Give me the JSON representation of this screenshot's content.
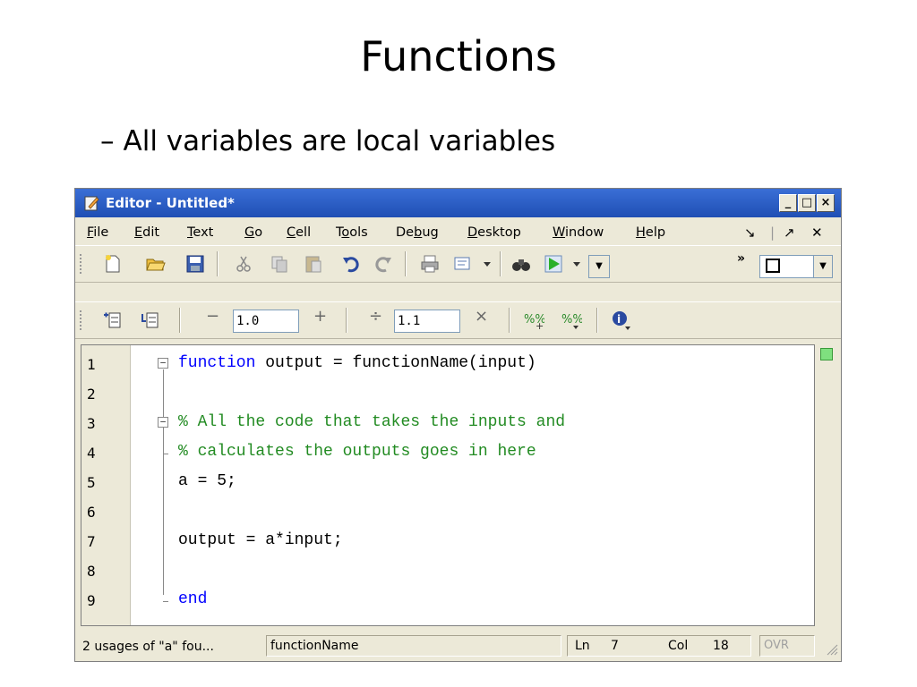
{
  "slide": {
    "title": "Functions",
    "bullet_dash": "–",
    "bullet": "All variables are local variables"
  },
  "window": {
    "title": "Editor - Untitled*",
    "minimize": "_",
    "maximize": "□",
    "close": "×"
  },
  "menu": {
    "file": {
      "u": "F",
      "rest": "ile"
    },
    "edit": {
      "pre": "",
      "u": "E",
      "rest": "dit"
    },
    "text": {
      "u": "T",
      "rest": "ext"
    },
    "go": {
      "u": "G",
      "rest": "o"
    },
    "cell": {
      "u": "C",
      "rest": "ell"
    },
    "tools": {
      "pre": "T",
      "u": "o",
      "rest": "ols"
    },
    "debug": {
      "pre": "De",
      "u": "b",
      "rest": "ug"
    },
    "desktop": {
      "u": "D",
      "rest": "esktop"
    },
    "window": {
      "u": "W",
      "rest": "indow"
    },
    "help": {
      "u": "H",
      "rest": "elp"
    },
    "undock": "↘",
    "sep": "|",
    "dock": "↗",
    "close": "✕"
  },
  "toolbar2": {
    "minus": "−",
    "decrement_value": "1.0",
    "plus": "+",
    "divide": "÷",
    "multiplier_value": "1.1",
    "times": "×"
  },
  "code": {
    "lines": [
      {
        "n": "1"
      },
      {
        "n": "2"
      },
      {
        "n": "3"
      },
      {
        "n": "4"
      },
      {
        "n": "5"
      },
      {
        "n": "6"
      },
      {
        "n": "7"
      },
      {
        "n": "8"
      },
      {
        "n": "9"
      }
    ],
    "l1_kw": "function",
    "l1_rest": " output = functionName(input)",
    "l3": "% All the code that takes the inputs and",
    "l4": "% calculates the outputs goes in here",
    "l5": "a = 5;",
    "l7": "output = a*input;",
    "l9": "end",
    "fold_minus": "−"
  },
  "status": {
    "message": "2 usages of \"a\" fou...",
    "function": "functionName",
    "ln_label": "Ln",
    "ln_value": "7",
    "col_label": "Col",
    "col_value": "18",
    "ovr": "OVR"
  }
}
